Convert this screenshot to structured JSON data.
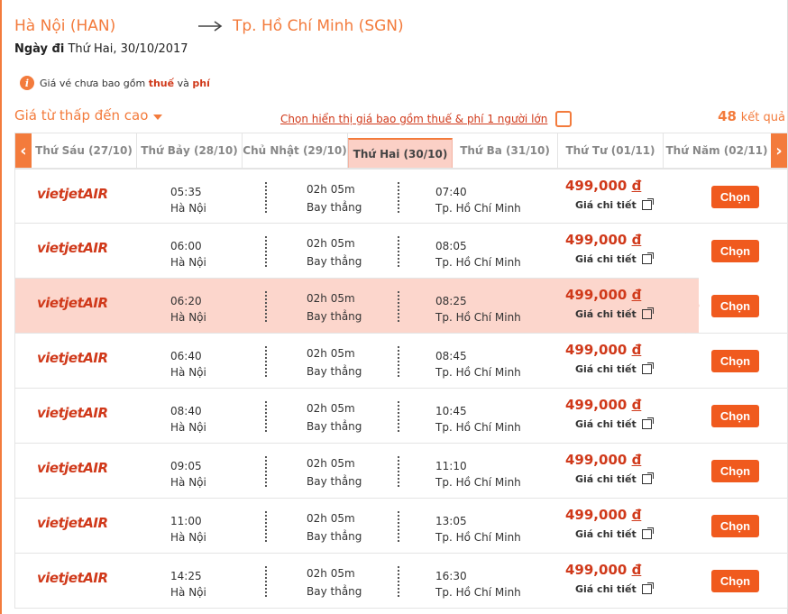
{
  "route": {
    "origin": "Hà Nội (HAN)",
    "destination": "Tp. Hồ Chí Minh (SGN)"
  },
  "departure": {
    "label": "Ngày đi",
    "date": "Thứ Hai, 30/10/2017"
  },
  "notice": {
    "prefix": "Giá vé chưa bao gồm",
    "tax": "thuế",
    "and": "và",
    "fee": "phí"
  },
  "sort": {
    "label": "Giá từ thấp đến cao"
  },
  "include_tax": {
    "label": "Chọn hiển thị giá bao gồm thuế & phí 1 người lớn",
    "checked": false
  },
  "results": {
    "count": "48",
    "unit": "kết quả"
  },
  "date_tabs": [
    {
      "label": "Thứ Sáu (27/10)"
    },
    {
      "label": "Thứ Bảy (28/10)"
    },
    {
      "label": "Chủ Nhật (29/10)"
    },
    {
      "label": "Thứ Hai (30/10)"
    },
    {
      "label": "Thứ Ba (31/10)"
    },
    {
      "label": "Thứ Tư (01/11)"
    },
    {
      "label": "Thứ Năm (02/11)"
    }
  ],
  "active_tab_index": 3,
  "colors": {
    "accent": "#f37b3c",
    "price": "#d0391a",
    "button": "#f05a1e",
    "selected_row": "#fcd6cc"
  },
  "airline_logo": {
    "brand": "vietjet",
    "text": "AIR"
  },
  "flights": [
    {
      "dep_time": "05:35",
      "dep_city": "Hà Nội",
      "duration": "02h 05m",
      "stops": "Bay thẳng",
      "arr_time": "07:40",
      "arr_city": "Tp. Hồ Chí Minh",
      "price": "499,000",
      "currency": "đ",
      "detail": "Giá chi tiết",
      "button": "Chọn"
    },
    {
      "dep_time": "06:00",
      "dep_city": "Hà Nội",
      "duration": "02h 05m",
      "stops": "Bay thẳng",
      "arr_time": "08:05",
      "arr_city": "Tp. Hồ Chí Minh",
      "price": "499,000",
      "currency": "đ",
      "detail": "Giá chi tiết",
      "button": "Chọn"
    },
    {
      "dep_time": "06:20",
      "dep_city": "Hà Nội",
      "duration": "02h 05m",
      "stops": "Bay thẳng",
      "arr_time": "08:25",
      "arr_city": "Tp. Hồ Chí Minh",
      "price": "499,000",
      "currency": "đ",
      "detail": "Giá chi tiết",
      "button": "Chọn"
    },
    {
      "dep_time": "06:40",
      "dep_city": "Hà Nội",
      "duration": "02h 05m",
      "stops": "Bay thẳng",
      "arr_time": "08:45",
      "arr_city": "Tp. Hồ Chí Minh",
      "price": "499,000",
      "currency": "đ",
      "detail": "Giá chi tiết",
      "button": "Chọn"
    },
    {
      "dep_time": "08:40",
      "dep_city": "Hà Nội",
      "duration": "02h 05m",
      "stops": "Bay thẳng",
      "arr_time": "10:45",
      "arr_city": "Tp. Hồ Chí Minh",
      "price": "499,000",
      "currency": "đ",
      "detail": "Giá chi tiết",
      "button": "Chọn"
    },
    {
      "dep_time": "09:05",
      "dep_city": "Hà Nội",
      "duration": "02h 05m",
      "stops": "Bay thẳng",
      "arr_time": "11:10",
      "arr_city": "Tp. Hồ Chí Minh",
      "price": "499,000",
      "currency": "đ",
      "detail": "Giá chi tiết",
      "button": "Chọn"
    },
    {
      "dep_time": "11:00",
      "dep_city": "Hà Nội",
      "duration": "02h 05m",
      "stops": "Bay thẳng",
      "arr_time": "13:05",
      "arr_city": "Tp. Hồ Chí Minh",
      "price": "499,000",
      "currency": "đ",
      "detail": "Giá chi tiết",
      "button": "Chọn"
    },
    {
      "dep_time": "14:25",
      "dep_city": "Hà Nội",
      "duration": "02h 05m",
      "stops": "Bay thẳng",
      "arr_time": "16:30",
      "arr_city": "Tp. Hồ Chí Minh",
      "price": "499,000",
      "currency": "đ",
      "detail": "Giá chi tiết",
      "button": "Chọn"
    }
  ],
  "selected_flight_index": 2
}
